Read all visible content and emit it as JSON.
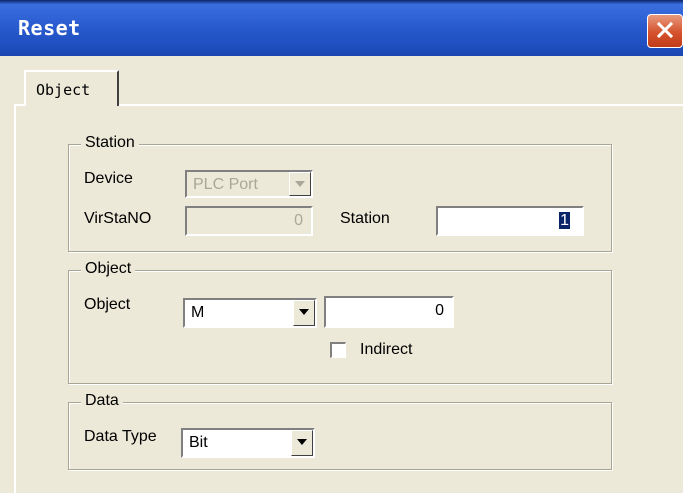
{
  "window": {
    "title": "Reset"
  },
  "tabs": [
    {
      "label": "Object"
    }
  ],
  "station_group": {
    "label": "Station",
    "device_label": "Device",
    "device_value": "PLC Port",
    "virstano_label": "VirStaNO",
    "virstano_value": "0",
    "station_label": "Station",
    "station_value": "1"
  },
  "object_group": {
    "label": "Object",
    "object_label": "Object",
    "object_type_value": "M",
    "object_address_value": "0",
    "indirect_label": "Indirect"
  },
  "data_group": {
    "label": "Data",
    "data_type_label": "Data Type",
    "data_type_value": "Bit"
  }
}
